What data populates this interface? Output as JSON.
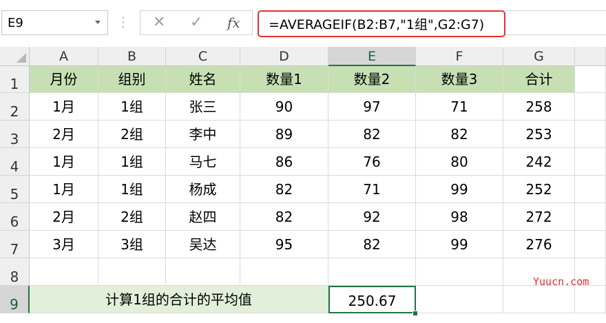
{
  "name_box": "E9",
  "formula": "=AVERAGEIF(B2:B7,\"1组\",G2:G7)",
  "columns": [
    "A",
    "B",
    "C",
    "D",
    "E",
    "F",
    "G"
  ],
  "rows": [
    "1",
    "2",
    "3",
    "4",
    "5",
    "6",
    "7",
    "8",
    "9"
  ],
  "header": [
    "月份",
    "组别",
    "姓名",
    "数量1",
    "数量2",
    "数量3",
    "合计"
  ],
  "data": [
    [
      "1月",
      "1组",
      "张三",
      "90",
      "97",
      "71",
      "258"
    ],
    [
      "2月",
      "2组",
      "李中",
      "89",
      "82",
      "82",
      "253"
    ],
    [
      "1月",
      "1组",
      "马七",
      "86",
      "76",
      "80",
      "242"
    ],
    [
      "1月",
      "1组",
      "杨成",
      "82",
      "71",
      "99",
      "252"
    ],
    [
      "2月",
      "2组",
      "赵四",
      "82",
      "92",
      "98",
      "272"
    ],
    [
      "3月",
      "3组",
      "吴达",
      "95",
      "82",
      "99",
      "276"
    ]
  ],
  "label_row9": "计算1组的合计的平均值",
  "result": "250.67",
  "watermark": "Yuucn.com",
  "colors": {
    "header_fill": "#c6e0b4",
    "label_fill": "#e2efda",
    "selection": "#217346",
    "formula_outline": "#e03030"
  }
}
